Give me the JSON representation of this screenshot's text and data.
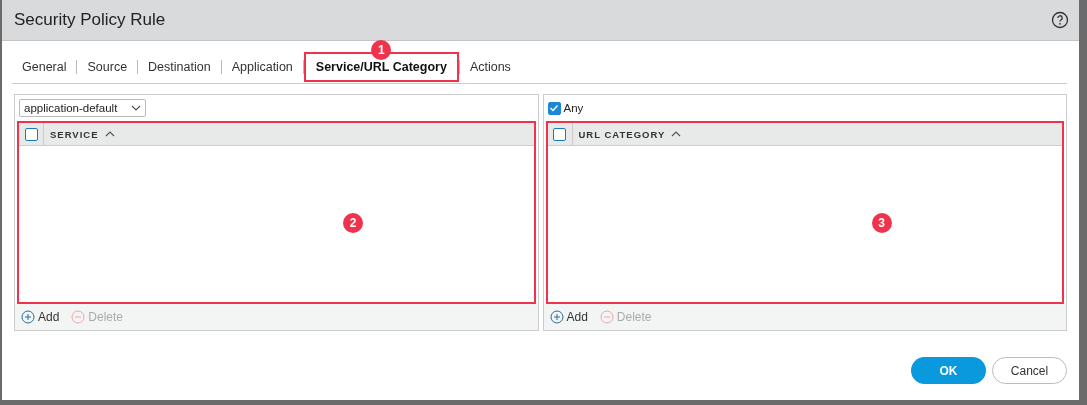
{
  "window": {
    "title": "Security Policy Rule"
  },
  "tabs": [
    {
      "label": "General",
      "selected": false
    },
    {
      "label": "Source",
      "selected": false
    },
    {
      "label": "Destination",
      "selected": false
    },
    {
      "label": "Application",
      "selected": false
    },
    {
      "label": "Service/URL Category",
      "selected": true,
      "callout": "1"
    },
    {
      "label": "Actions",
      "selected": false
    }
  ],
  "panels": [
    {
      "kind": "dropdown",
      "dropdown": {
        "value": "application-default"
      },
      "column": "SERVICE",
      "header_checked": false,
      "callout": "2",
      "add": "Add",
      "delete": "Delete"
    },
    {
      "kind": "checkbox",
      "any": {
        "label": "Any",
        "checked": true
      },
      "column": "URL CATEGORY",
      "header_checked": false,
      "callout": "3",
      "add": "Add",
      "delete": "Delete"
    }
  ],
  "buttons": [
    {
      "label": "OK",
      "kind": "primary"
    },
    {
      "label": "Cancel",
      "kind": "secondary"
    }
  ]
}
